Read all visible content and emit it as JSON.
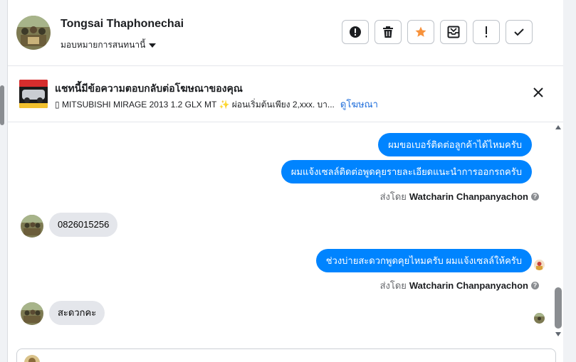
{
  "header": {
    "contact_name": "Tongsai Thaphonechai",
    "assign_label": "มอบหมายการสนทนานี้",
    "actions": [
      {
        "name": "report-spam-button",
        "icon": "alert-circle-icon"
      },
      {
        "name": "delete-button",
        "icon": "trash-icon"
      },
      {
        "name": "star-button",
        "icon": "star-icon"
      },
      {
        "name": "move-to-inbox-button",
        "icon": "inbox-move-icon"
      },
      {
        "name": "mark-follow-up-button",
        "icon": "exclamation-icon"
      },
      {
        "name": "mark-done-button",
        "icon": "check-icon"
      }
    ]
  },
  "ad_banner": {
    "title": "แชทนี้มีข้อความตอบกลับต่อโฆษณาของคุณ",
    "subtitle": "▯ MITSUBISHI MIRAGE 2013 1.2 GLX MT ✨ ผ่อนเริ่มต้นเพียง 2,xxx. บา...",
    "link_label": "ดูโฆษณา"
  },
  "messages": {
    "out_1": "ผมขอเบอร์ติดต่อลูกค้าได้ไหมครับ",
    "out_2": "ผมแจ้งเซลล์ติดต่อพูดคุยรายละเอียดแนะนำการออกรถครับ",
    "sent_by_prefix_1": "ส่งโดย",
    "sent_by_name_1": "Watcharin Chanpanyachon",
    "in_1": "0826015256",
    "out_3": "ช่วงบ่ายสะดวกพูดคุยไหมครับ ผมแจ้งเซลล์ให้ครับ",
    "sent_by_prefix_2": "ส่งโดย",
    "sent_by_name_2": "Watcharin Chanpanyachon",
    "in_2": "สะดวกคะ",
    "help_icon_text": "?"
  },
  "colors": {
    "accent": "#0084ff",
    "star": "#f7923b",
    "link": "#216fdb",
    "incoming_bubble": "#e4e6eb"
  }
}
